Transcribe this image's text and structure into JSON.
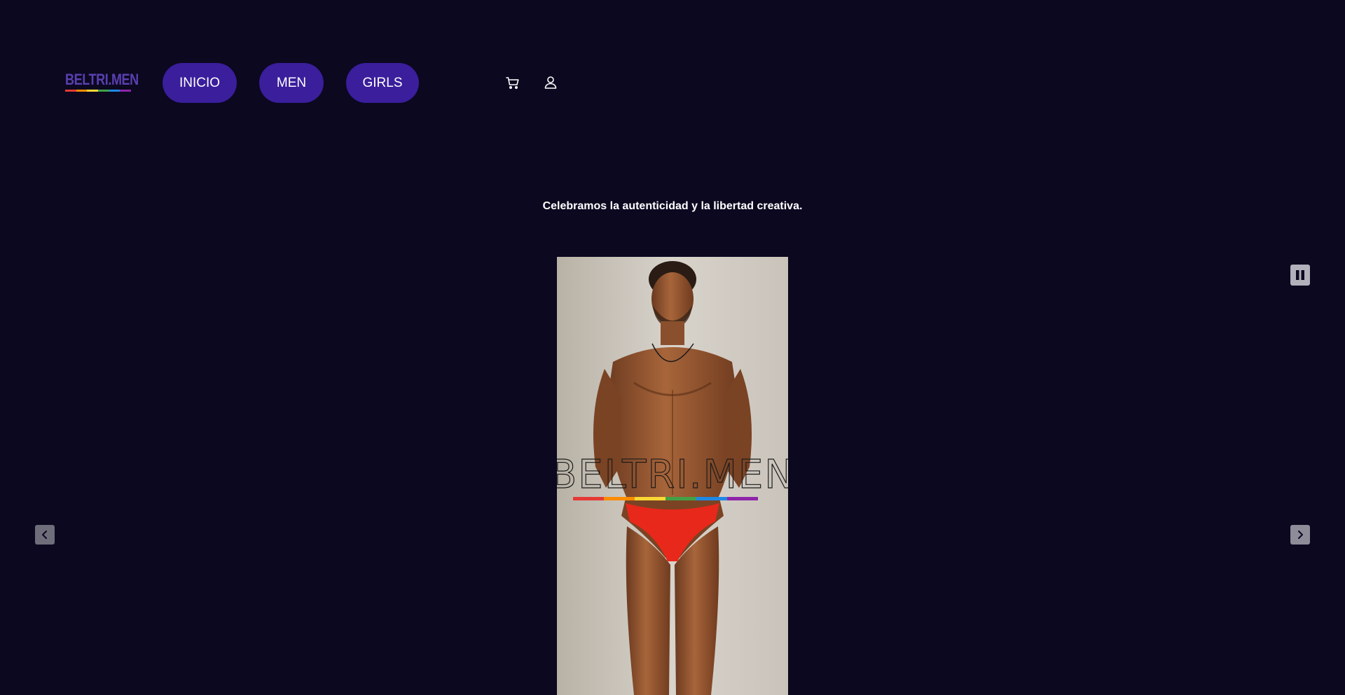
{
  "header": {
    "logo_text": "BELTRI.MEN",
    "logo_stripes": [
      "#e53935",
      "#fb8c00",
      "#fdd835",
      "#43a047",
      "#1e88e5",
      "#8e24aa"
    ],
    "nav": [
      {
        "label": "INICIO"
      },
      {
        "label": "MEN"
      },
      {
        "label": "GIRLS"
      }
    ],
    "icons": [
      "cart-icon",
      "account-icon"
    ]
  },
  "hero": {
    "tagline": "Celebramos la autenticidad y la libertad creativa.",
    "slide": {
      "watermark_text": "BELTRI.MEN",
      "watermark_stripes": [
        "#e53935",
        "#fb8c00",
        "#fdd835",
        "#43a047",
        "#1e88e5",
        "#8e24aa"
      ]
    },
    "controls": [
      "pause-icon",
      "chevron-left-icon",
      "chevron-right-icon"
    ]
  },
  "colors": {
    "background": "#0b0820",
    "nav_button": "#3a1e9c",
    "logo_text": "#5a3fb0"
  }
}
